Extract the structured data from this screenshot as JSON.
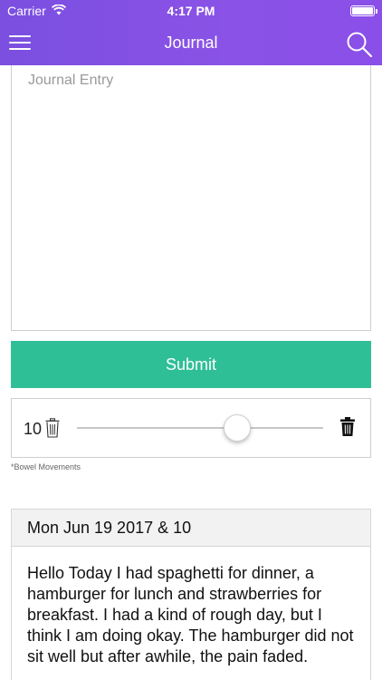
{
  "status_bar": {
    "carrier": "Carrier",
    "time": "4:17 PM"
  },
  "nav": {
    "title": "Journal",
    "menu_icon": "hamburger-menu-icon",
    "search_icon": "search-icon"
  },
  "journal_form": {
    "entry_placeholder": "Journal Entry",
    "entry_value": "",
    "submit_label": "Submit"
  },
  "bowel_slider": {
    "value_label": "10",
    "value_fraction": 0.65,
    "caption": "*Bowel Movements",
    "left_icon": "trash-outline-icon",
    "right_icon": "trash-filled-icon"
  },
  "entries": [
    {
      "header": "Mon Jun 19 2017 & 10",
      "body": "Hello Today I had spaghetti for dinner, a hamburger for lunch and strawberries for breakfast. I had a kind of rough day, but I think I am doing okay. The hamburger did not sit well but after awhile, the pain faded."
    }
  ],
  "colors": {
    "header_purple": "#8a52e6",
    "submit_green": "#2fbf97"
  }
}
